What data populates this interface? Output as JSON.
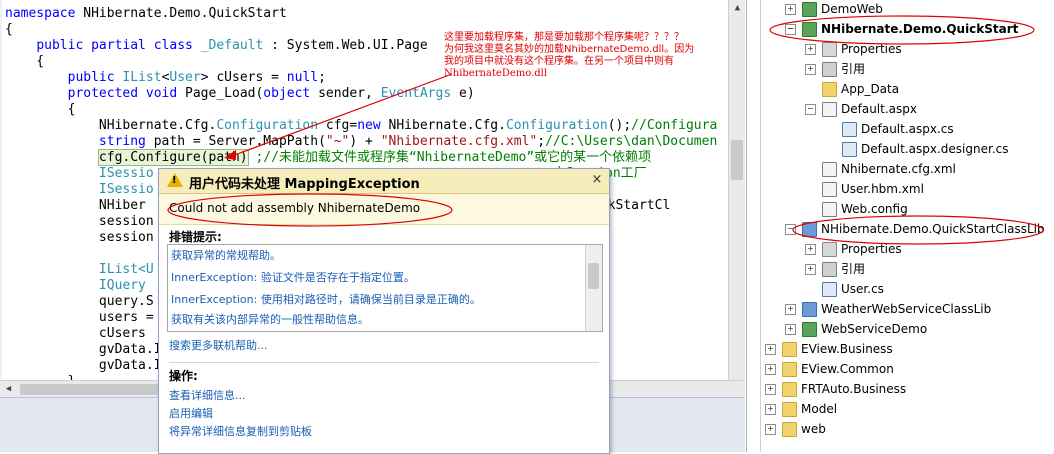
{
  "editor": {
    "lines": [
      {
        "segs": [
          {
            "c": "kw",
            "t": "namespace"
          },
          {
            "c": "",
            "t": " NHibernate.Demo.QuickStart"
          }
        ]
      },
      {
        "segs": [
          {
            "c": "",
            "t": "{"
          }
        ]
      },
      {
        "segs": [
          {
            "c": "",
            "t": "    "
          },
          {
            "c": "kw",
            "t": "public partial class"
          },
          {
            "c": "",
            "t": " "
          },
          {
            "c": "ty",
            "t": "_Default"
          },
          {
            "c": "",
            "t": " : System.Web.UI.Page"
          }
        ]
      },
      {
        "segs": [
          {
            "c": "",
            "t": "    {"
          }
        ]
      },
      {
        "segs": [
          {
            "c": "",
            "t": "        "
          },
          {
            "c": "kw",
            "t": "public"
          },
          {
            "c": "",
            "t": " "
          },
          {
            "c": "ty",
            "t": "IList"
          },
          {
            "c": "",
            "t": "<"
          },
          {
            "c": "ty",
            "t": "User"
          },
          {
            "c": "",
            "t": "> cUsers = "
          },
          {
            "c": "kw",
            "t": "null"
          },
          {
            "c": "",
            "t": ";"
          }
        ]
      },
      {
        "segs": [
          {
            "c": "",
            "t": "        "
          },
          {
            "c": "kw",
            "t": "protected void"
          },
          {
            "c": "",
            "t": " Page_Load("
          },
          {
            "c": "kw",
            "t": "object"
          },
          {
            "c": "",
            "t": " sender, "
          },
          {
            "c": "ty",
            "t": "EventArgs"
          },
          {
            "c": "",
            "t": " e)"
          }
        ]
      },
      {
        "segs": [
          {
            "c": "",
            "t": "        {"
          }
        ]
      },
      {
        "segs": [
          {
            "c": "",
            "t": "            NHibernate.Cfg."
          },
          {
            "c": "ty",
            "t": "Configuration"
          },
          {
            "c": "",
            "t": " cfg="
          },
          {
            "c": "kw",
            "t": "new"
          },
          {
            "c": "",
            "t": " NHibernate.Cfg."
          },
          {
            "c": "ty",
            "t": "Configuration"
          },
          {
            "c": "",
            "t": "();"
          },
          {
            "c": "cm",
            "t": "//Configura"
          }
        ]
      },
      {
        "segs": [
          {
            "c": "",
            "t": "            "
          },
          {
            "c": "kw",
            "t": "string"
          },
          {
            "c": "",
            "t": " path = Server.MapPath("
          },
          {
            "c": "st",
            "t": "\"~\""
          },
          {
            "c": "",
            "t": ") + "
          },
          {
            "c": "st",
            "t": "\"Nhibernate.cfg.xml\""
          },
          {
            "c": "",
            "t": ";"
          },
          {
            "c": "cm",
            "t": "//C:\\Users\\dan\\Documen"
          }
        ]
      },
      {
        "segs": [
          {
            "c": "",
            "t": "            "
          },
          {
            "c": "hl",
            "t": "cfg.Configure(path)"
          },
          {
            "c": "",
            "t": " "
          },
          {
            "c": "cm",
            "t": ";//未能加载文件或程序集“NhibernateDemo”或它的某一个依赖项"
          }
        ]
      },
      {
        "segs": [
          {
            "c": "",
            "t": "            "
          },
          {
            "c": "ty",
            "t": "ISessio"
          },
          {
            "c": "",
            "t": "                                                   "
          },
          {
            "c": "cm",
            "t": "立Session工厂"
          }
        ]
      },
      {
        "segs": [
          {
            "c": "",
            "t": "            "
          },
          {
            "c": "ty",
            "t": "ISessio"
          }
        ]
      },
      {
        "segs": [
          {
            "c": "",
            "t": "            NHiber"
          },
          {
            "c": "",
            "t": "                                                   emo.QuickStartCl"
          }
        ]
      },
      {
        "segs": [
          {
            "c": "",
            "t": "            session"
          }
        ]
      },
      {
        "segs": [
          {
            "c": "",
            "t": "            session"
          }
        ]
      },
      {
        "segs": [
          {
            "c": "",
            "t": ""
          }
        ]
      },
      {
        "segs": [
          {
            "c": "",
            "t": "            "
          },
          {
            "c": "ty",
            "t": "IList<U"
          }
        ]
      },
      {
        "segs": [
          {
            "c": "",
            "t": "            "
          },
          {
            "c": "ty",
            "t": "IQuery"
          },
          {
            "c": "",
            "t": "                                                   );"
          }
        ]
      },
      {
        "segs": [
          {
            "c": "",
            "t": "            query.S"
          }
        ]
      },
      {
        "segs": [
          {
            "c": "",
            "t": "            users ="
          }
        ]
      },
      {
        "segs": [
          {
            "c": "",
            "t": "            cUsers "
          }
        ]
      },
      {
        "segs": [
          {
            "c": "",
            "t": "            gvData.I"
          }
        ]
      },
      {
        "segs": [
          {
            "c": "",
            "t": "            gvData.I"
          }
        ]
      },
      {
        "segs": [
          {
            "c": "",
            "t": "        }"
          }
        ]
      }
    ]
  },
  "annotation": {
    "line1": "这里要加载程序集，那是要加载那个程序集呢？？？？",
    "line2": "为何我这里莫名其妙的加载NhibernateDemo.dll。因为",
    "line3": "我的项目中就没有这个程序集。在另一个项目中则有",
    "line4": "NhibernateDemo.dll",
    "color": "#e00000"
  },
  "exception": {
    "title": "用户代码未处理 MappingException",
    "close_glyph": "×",
    "message": "Could not add assembly NhibernateDemo",
    "tips_label": "排错提示:",
    "tips": [
      "获取异常的常规帮助。",
      "InnerException: 验证文件是否存在于指定位置。",
      "InnerException: 使用相对路径时，请确保当前目录是正确的。",
      "获取有关该内部异常的一般性帮助信息。"
    ],
    "more_help": "搜索更多联机帮助...",
    "actions_label": "操作:",
    "actions": [
      "查看详细信息...",
      "启用编辑",
      "将异常详细信息复制到剪贴板"
    ]
  },
  "solution_tree": [
    {
      "depth": 0,
      "exp": "+",
      "icon": "web",
      "label": "DemoWeb",
      "bold": false
    },
    {
      "depth": 0,
      "exp": "−",
      "icon": "web",
      "label": "NHibernate.Demo.QuickStart",
      "bold": true
    },
    {
      "depth": 1,
      "exp": "+",
      "icon": "prop",
      "label": "Properties",
      "bold": false
    },
    {
      "depth": 1,
      "exp": "+",
      "icon": "ref",
      "label": "引用",
      "bold": false
    },
    {
      "depth": 1,
      "exp": "",
      "icon": "folder",
      "label": "App_Data",
      "bold": false
    },
    {
      "depth": 1,
      "exp": "−",
      "icon": "file",
      "label": "Default.aspx",
      "bold": false
    },
    {
      "depth": 2,
      "exp": "",
      "icon": "cs",
      "label": "Default.aspx.cs",
      "bold": false
    },
    {
      "depth": 2,
      "exp": "",
      "icon": "cs",
      "label": "Default.aspx.designer.cs",
      "bold": false
    },
    {
      "depth": 1,
      "exp": "",
      "icon": "file",
      "label": "Nhibernate.cfg.xml",
      "bold": false
    },
    {
      "depth": 1,
      "exp": "",
      "icon": "file",
      "label": "User.hbm.xml",
      "bold": false
    },
    {
      "depth": 1,
      "exp": "",
      "icon": "file",
      "label": "Web.config",
      "bold": false
    },
    {
      "depth": 0,
      "exp": "−",
      "icon": "proj",
      "label": "NHibernate.Demo.QuickStartClassLib",
      "bold": false
    },
    {
      "depth": 1,
      "exp": "+",
      "icon": "prop",
      "label": "Properties",
      "bold": false
    },
    {
      "depth": 1,
      "exp": "+",
      "icon": "ref",
      "label": "引用",
      "bold": false
    },
    {
      "depth": 1,
      "exp": "",
      "icon": "cs",
      "label": "User.cs",
      "bold": false
    },
    {
      "depth": 0,
      "exp": "+",
      "icon": "proj",
      "label": "WeatherWebServiceClassLib",
      "bold": false
    },
    {
      "depth": 0,
      "exp": "+",
      "icon": "web",
      "label": "WebServiceDemo",
      "bold": false
    },
    {
      "depth": -1,
      "exp": "+",
      "icon": "folder",
      "label": "EView.Business",
      "bold": false
    },
    {
      "depth": -1,
      "exp": "+",
      "icon": "folder",
      "label": "EView.Common",
      "bold": false
    },
    {
      "depth": -1,
      "exp": "+",
      "icon": "folder",
      "label": "FRTAuto.Business",
      "bold": false
    },
    {
      "depth": -1,
      "exp": "+",
      "icon": "folder",
      "label": "Model",
      "bold": false
    },
    {
      "depth": -1,
      "exp": "+",
      "icon": "folder",
      "label": "web",
      "bold": false
    }
  ],
  "scroll_glyphs": {
    "up": "▲",
    "left": "◀"
  },
  "colors": {
    "annotation": "#e00000",
    "link": "#1a5fb4",
    "dialog_title_bg": "#f7edbb"
  }
}
